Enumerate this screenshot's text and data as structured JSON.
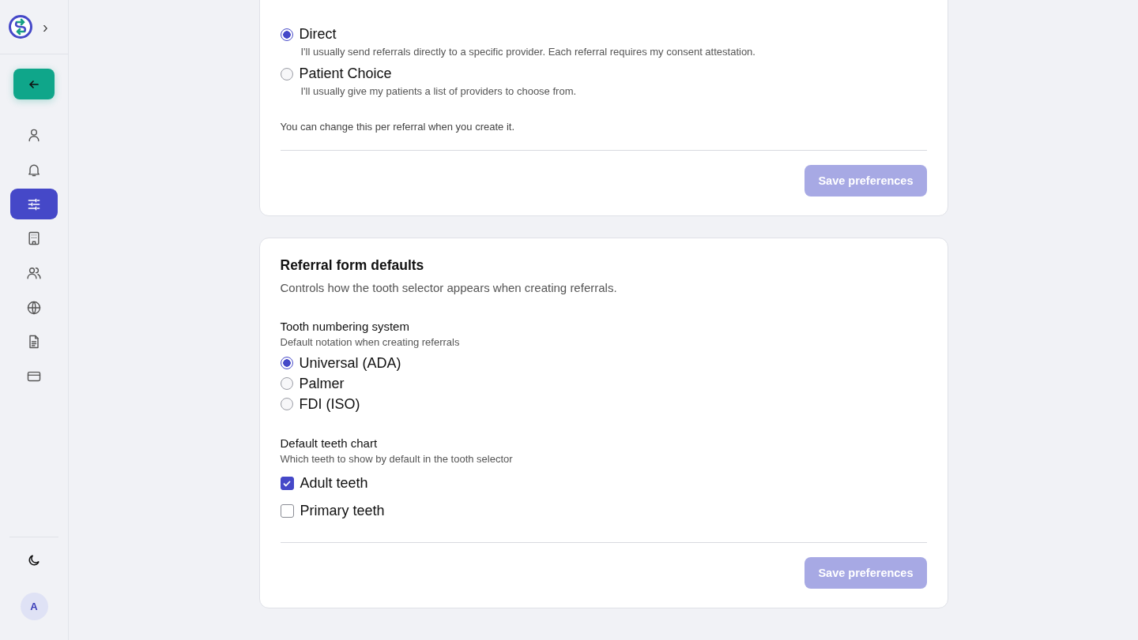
{
  "sidebar": {
    "expand_icon": "›",
    "back_button": {
      "kind": "back"
    },
    "items": [
      {
        "kind": "user",
        "selected": false
      },
      {
        "kind": "bell",
        "selected": false
      },
      {
        "kind": "sliders",
        "selected": true
      },
      {
        "kind": "building",
        "selected": false
      },
      {
        "kind": "users",
        "selected": false
      },
      {
        "kind": "globe",
        "selected": false
      },
      {
        "kind": "document",
        "selected": false
      },
      {
        "kind": "card",
        "selected": false
      }
    ],
    "avatar": "A"
  },
  "mode_card": {
    "options": [
      {
        "label": "Direct",
        "description": "I'll usually send referrals directly to a specific provider. Each referral requires my consent attestation.",
        "selected": true
      },
      {
        "label": "Patient Choice",
        "description": "I'll usually give my patients a list of providers to choose from.",
        "selected": false
      }
    ],
    "note": "You can change this per referral when you create it.",
    "save_button": "Save preferences"
  },
  "form_card": {
    "title": "Referral form defaults",
    "subtitle": "Controls how the tooth selector appears when creating referrals.",
    "numbering": {
      "label": "Tooth numbering system",
      "hint": "Default notation when creating referrals",
      "options": [
        {
          "label": "Universal (ADA)",
          "selected": true
        },
        {
          "label": "Palmer",
          "selected": false
        },
        {
          "label": "FDI (ISO)",
          "selected": false
        }
      ]
    },
    "chart": {
      "label": "Default teeth chart",
      "hint": "Which teeth to show by default in the tooth selector",
      "options": [
        {
          "label": "Adult teeth",
          "checked": true
        },
        {
          "label": "Primary teeth",
          "checked": false
        }
      ]
    },
    "save_button": "Save preferences"
  }
}
